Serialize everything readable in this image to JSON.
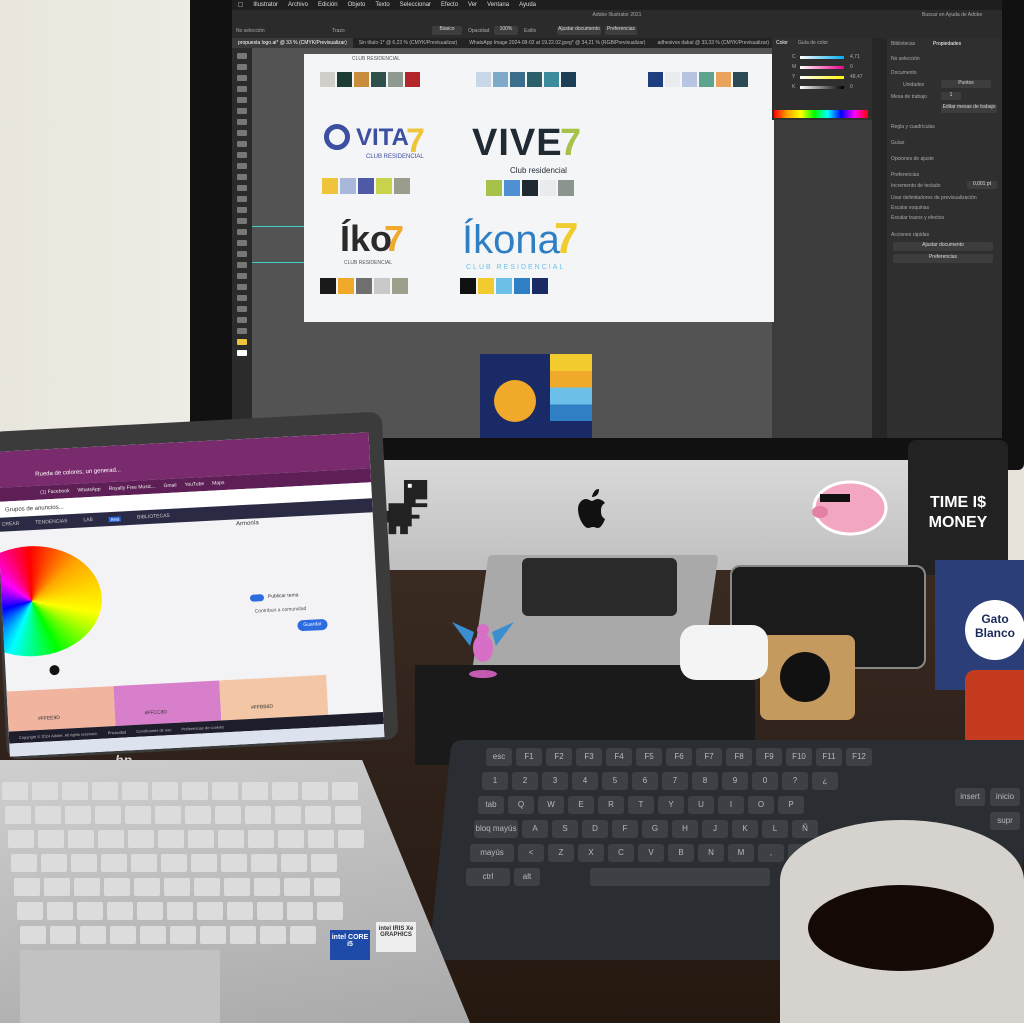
{
  "menubar": {
    "items": [
      "Illustrator",
      "Archivo",
      "Edición",
      "Objeto",
      "Texto",
      "Seleccionar",
      "Efecto",
      "Ver",
      "Ventana",
      "Ayuda"
    ],
    "app_title": "Adobe Illustrator 2021",
    "search_placeholder": "Buscar en Ayuda de Adobe"
  },
  "control_bar": {
    "selection": "No selección",
    "stroke_label": "Trazo",
    "style_label": "Básico",
    "opacity_label": "Opacidad",
    "opacity_value": "100%",
    "style2": "Estilo",
    "doc_setup_button": "Ajustar documento",
    "prefs_button": "Preferencias"
  },
  "tabs": [
    "propuesta logo.ai* @ 33 % (CMYK/Previsualizar)",
    "Sin título-1* @ 6,23 % (CMYK/Previsualizar)",
    "WhatsApp Image 2024-08-02 at 19.22.02.jpeg* @ 34,21 % (RGB/Previsualizar)",
    "adhesivos dakaí @ 33,33 % (CMYK/Previsualizar)"
  ],
  "color_panel": {
    "tab1": "Color",
    "tab2": "Guía de color",
    "values": [
      "4,71",
      "0",
      "48,47",
      "0"
    ],
    "labels": [
      "C",
      "M",
      "Y",
      "K"
    ]
  },
  "properties_panel": {
    "tab1": "Bibliotecas",
    "tab2": "Propiedades",
    "no_selection": "No selección",
    "section_document": "Documento",
    "units_label": "Unidades",
    "units_value": "Puntos",
    "artboard_label": "Mesa de trabajo",
    "artboard_value": "1",
    "edit_artboards_button": "Editar mesas de trabajo",
    "rulers_label": "Regla y cuadrículas",
    "guides_label": "Guías",
    "snap_label": "Opciones de ajuste",
    "prefs_section": "Preferencias",
    "keyboard_increment_label": "Incremento de teclado",
    "keyboard_increment_value": "0,001 pt",
    "checkbox_1": "Usar delimitadores de previsualización",
    "checkbox_2": "Escalar esquinas",
    "checkbox_3": "Escalar trazos y efectos",
    "quick_actions": "Acciones rápidas",
    "doc_setup_button": "Ajustar documento",
    "prefs_button": "Preferencias"
  },
  "artboard": {
    "top_caption": "CLUB RESIDENCIAL",
    "logos": [
      {
        "name": "VITA7",
        "main": "VITA",
        "seven": "7",
        "sub": "CLUB RESIDENCIAL",
        "colors": [
          "#f0c43a",
          "#a9b8da",
          "#4e5aa8",
          "#c8d24a",
          "#9a9c8e"
        ]
      },
      {
        "name": "VIVE7",
        "main": "VIVE",
        "seven": "7",
        "sub": "Club residencial",
        "colors": [
          "#a6c24a",
          "#4f8fd4",
          "#1f2a33",
          "#e9ebee",
          "#8b9590"
        ]
      },
      {
        "name": "IKO7",
        "main": "Íko",
        "seven": "7",
        "sub": "CLUB RESIDENCIAL",
        "colors": [
          "#1a1a1a",
          "#f0a92a",
          "#6f6f6f",
          "#c9c9c9",
          "#9c9f8a"
        ]
      },
      {
        "name": "IKONA7",
        "main": "Íkona",
        "seven": "7",
        "sub": "CLUB RESIDENCIAL",
        "colors": [
          "#111111",
          "#f2cc2e",
          "#6cbfe8",
          "#2f7fc4",
          "#1a2a66"
        ]
      }
    ],
    "top_swatches_left": [
      "#d0cfc9",
      "#1d3d34",
      "#c78d3a",
      "#2f4f4a",
      "#8e9a90",
      "#b3262b"
    ],
    "top_swatches_mid": [
      "#c8d8e8",
      "#7fa9c8",
      "#3b6d8c",
      "#2b5f6a",
      "#3b8b9c",
      "#1d3f56"
    ],
    "top_swatches_right": [
      "#1d3f80",
      "#e9ebee",
      "#b7c4e2",
      "#5ea38e",
      "#e9a35a",
      "#2b4a54"
    ]
  },
  "laptop": {
    "tab_title": "Rueda de colores, un generad...",
    "bookmarks": [
      "(1) Facebook",
      "WhatsApp",
      "Royalty Free Music...",
      "Gmail",
      "YouTube",
      "Maps"
    ],
    "group_label": "Grupos de anuncios...",
    "nav": [
      "CREAR",
      "TENDENCIAS",
      "LAB",
      "BIBLIOTECAS"
    ],
    "nav_badge": "Beta",
    "panel_title": "Armonía",
    "button_save": "Guardar",
    "toggle_label": "Publicar tema",
    "link_label": "Contribuir a comunidad",
    "footer_links": [
      "Copyright © 2024 Adobe. All rights reserved.",
      "Privacidad",
      "Condiciones de uso",
      "Preferencias de cookies"
    ],
    "swatch_labels": [
      "#FFEE9D",
      "#FFCC8D",
      "#FFBB8D"
    ],
    "brand": "hp",
    "sticker_intel": "intel CORE i5",
    "sticker_iris": "intel IRIS Xe GRAPHICS"
  },
  "keyboard": {
    "row1": [
      "esc",
      "F1",
      "F2",
      "F3",
      "F4",
      "F5",
      "F6",
      "F7",
      "F8",
      "F9",
      "F10",
      "F11",
      "F12"
    ],
    "row2": [
      "1",
      "2",
      "3",
      "4",
      "5",
      "6",
      "7",
      "8",
      "9",
      "0",
      "?",
      "¿"
    ],
    "row3": [
      "tab",
      "Q",
      "W",
      "E",
      "R",
      "T",
      "Y",
      "U",
      "I",
      "O",
      "P"
    ],
    "row4": [
      "bloq mayús",
      "A",
      "S",
      "D",
      "F",
      "G",
      "H",
      "J",
      "K",
      "L",
      "Ñ"
    ],
    "row5": [
      "mayús",
      "<",
      "Z",
      "X",
      "C",
      "V",
      "B",
      "N",
      "M",
      ",",
      "."
    ],
    "row6": [
      "ctrl",
      "alt"
    ],
    "side": [
      "insert",
      "inicio",
      "supr"
    ]
  },
  "stickers": {
    "wallet_line1": "TIME I$",
    "wallet_line2": "MONEY",
    "can_text": "Gato Blanco"
  }
}
